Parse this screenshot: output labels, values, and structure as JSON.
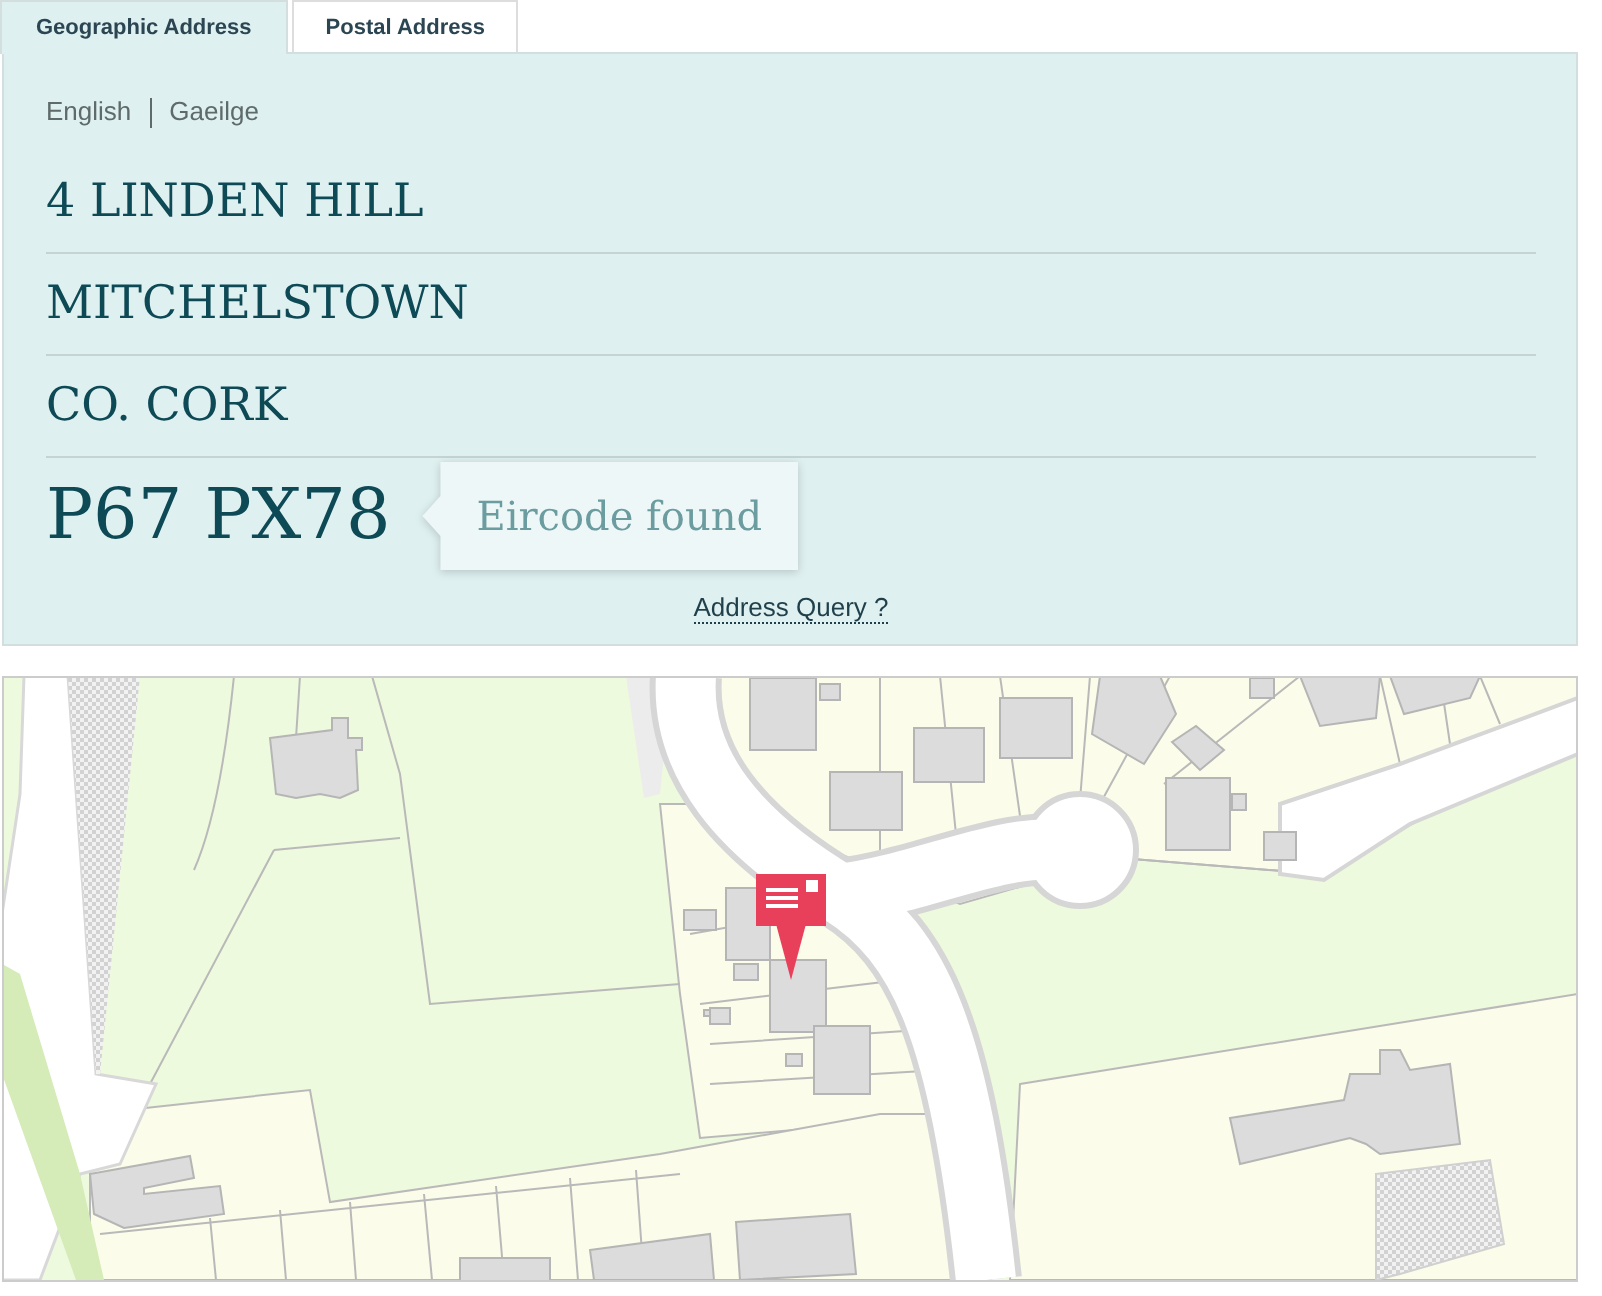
{
  "tabs": [
    {
      "label": "Geographic Address",
      "selected": true
    },
    {
      "label": "Postal Address",
      "selected": false
    }
  ],
  "languages": [
    "English",
    "Gaeilge"
  ],
  "address_lines": [
    "4 LINDEN HILL",
    "MITCHELSTOWN",
    "CO. CORK"
  ],
  "eircode": "P67 PX78",
  "status_tooltip": "Eircode found",
  "query_link": "Address Query ?"
}
